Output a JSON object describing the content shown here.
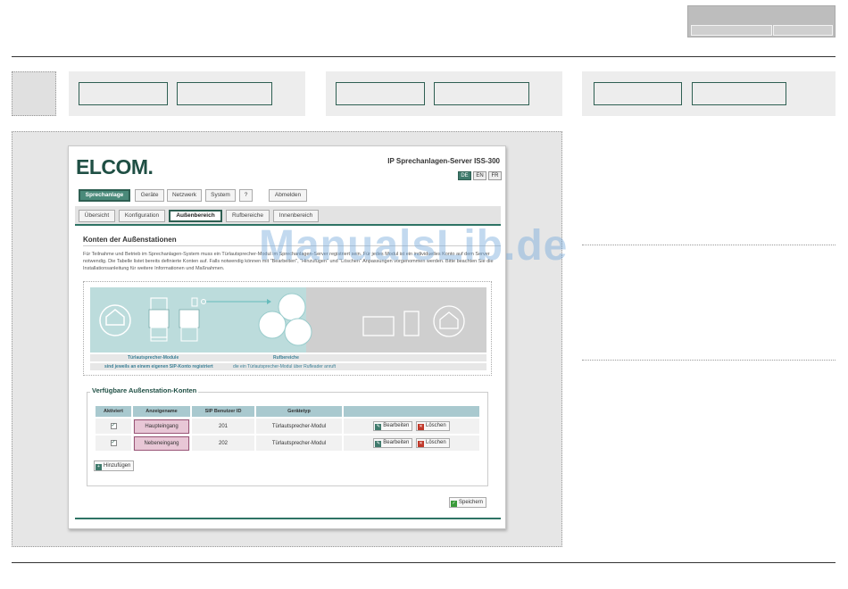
{
  "app": {
    "logo_text": "ELCOM.",
    "server_title": "IP Sprechanlagen-Server ISS-300",
    "languages": [
      {
        "code": "DE",
        "active": true
      },
      {
        "code": "EN",
        "active": false
      },
      {
        "code": "FR",
        "active": false
      }
    ]
  },
  "main_tabs": [
    {
      "label": "Sprechanlage",
      "active": true
    },
    {
      "label": "Geräte",
      "active": false
    },
    {
      "label": "Netzwerk",
      "active": false
    },
    {
      "label": "System",
      "active": false
    },
    {
      "label": "?",
      "active": false
    },
    {
      "label": "Abmelden",
      "active": false
    }
  ],
  "sub_tabs": [
    {
      "label": "Übersicht",
      "active": false
    },
    {
      "label": "Konfiguration",
      "active": false
    },
    {
      "label": "Außenbereich",
      "active": true
    },
    {
      "label": "Rufbereiche",
      "active": false
    },
    {
      "label": "Innenbereich",
      "active": false
    }
  ],
  "section": {
    "title": "Konten der Außenstationen",
    "description": "Für Teilnahme und Betrieb im Sprechanlagen-System muss ein Türlautsprecher-Modul im Sprechanlagen-Server registriert sein. Für jedes Modul ist ein individuelles Konto auf dem Server notwendig. Die Tabelle listet bereits definierte Konten auf. Falls notwendig können mit \"Bearbeiten\", \"Hinzufügen\" und \"Löschen\" Anpassungen vorgenommen werden. Bitte beachten Sie die Installationsanleitung für weitere Informationen und Maßnahmen."
  },
  "diagram": {
    "label_left": "Türlautsprecher-Module",
    "label_right": "Rufbereiche",
    "sub_left": "sind jeweils an einem eigenen SIP-Konto registriert",
    "sub_right": "die ein Türlautsprecher-Modul über Rufleader anruft"
  },
  "accounts": {
    "legend": "Verfügbare Außenstation-Konten",
    "headers": {
      "active": "Aktiviert",
      "name": "Anzeigename",
      "sip": "SIP Benutzer ID",
      "type": "Gerätetyp"
    },
    "rows": [
      {
        "active": true,
        "name": "Haupteingang",
        "sip": "201",
        "type": "Türlautsprecher-Modul"
      },
      {
        "active": true,
        "name": "Nebeneingang",
        "sip": "202",
        "type": "Türlautsprecher-Modul"
      }
    ],
    "edit_label": "Bearbeiten",
    "delete_label": "Löschen",
    "add_label": "Hinzufügen"
  },
  "save_label": "Speichern",
  "watermark": "ManualsLib.de",
  "colors": {
    "accent": "#2e5f52",
    "selected_name_bg": "#e8c7d6",
    "header_bg": "#a9c9cf"
  }
}
